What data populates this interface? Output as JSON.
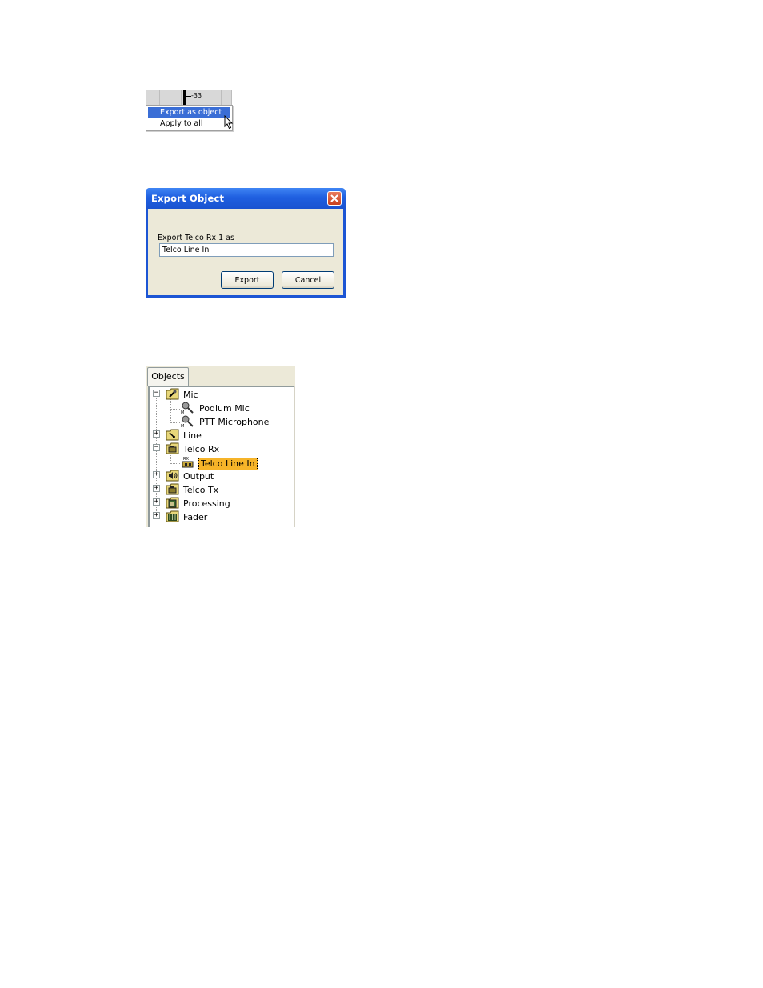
{
  "context_menu": {
    "fader_value": "-33",
    "items": [
      {
        "label": "Export as object",
        "selected": true
      },
      {
        "label": "Apply to all",
        "selected": false
      }
    ]
  },
  "export_dialog": {
    "title": "Export Object",
    "prompt": "Export Telco Rx 1 as",
    "name_value": "Telco Line In",
    "export_label": "Export",
    "cancel_label": "Cancel"
  },
  "objects_panel": {
    "tab_label": "Objects",
    "tree": [
      {
        "label": "Mic",
        "expanded": true,
        "icon": "mic-folder-icon",
        "children": [
          {
            "label": "Podium Mic",
            "icon": "microphone-icon"
          },
          {
            "label": "PTT Microphone",
            "icon": "microphone-icon"
          }
        ]
      },
      {
        "label": "Line",
        "expanded": false,
        "icon": "line-folder-icon"
      },
      {
        "label": "Telco Rx",
        "expanded": true,
        "icon": "telco-rx-folder-icon",
        "children": [
          {
            "label": "Telco Line In",
            "icon": "telco-rx-icon",
            "selected": true
          }
        ]
      },
      {
        "label": "Output",
        "expanded": false,
        "icon": "speaker-folder-icon"
      },
      {
        "label": "Telco Tx",
        "expanded": false,
        "icon": "telco-tx-folder-icon"
      },
      {
        "label": "Processing",
        "expanded": false,
        "icon": "processing-folder-icon"
      },
      {
        "label": "Fader",
        "expanded": false,
        "icon": "fader-folder-icon"
      }
    ]
  },
  "colors": {
    "menu_highlight": "#3a6ed6",
    "title_bar": "#1f5fe0",
    "dialog_face": "#ece9d8",
    "tree_selection": "#f6b429"
  }
}
